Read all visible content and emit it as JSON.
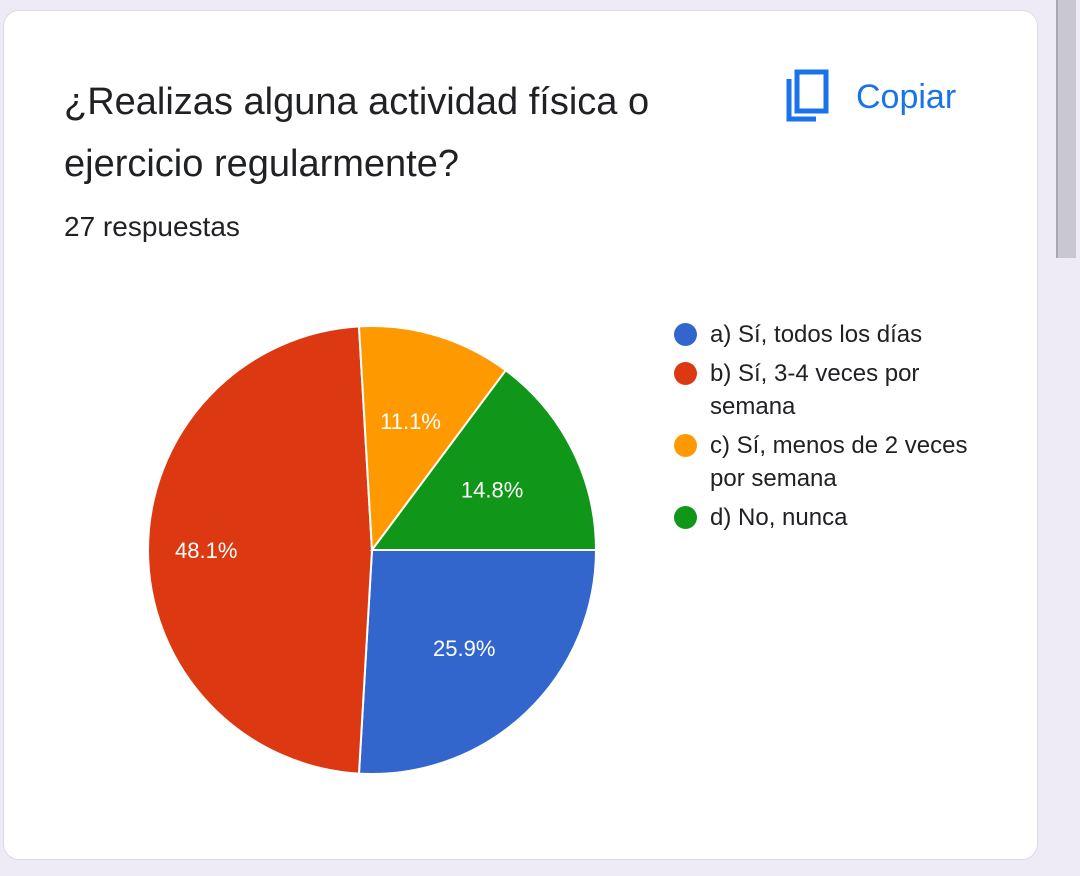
{
  "card": {
    "title": "¿Realizas alguna actividad física o ejercicio regularmente?",
    "copy_label": "Copiar",
    "copy_icon": "copy-icon",
    "responses_text": "27 respuestas"
  },
  "colors": {
    "accent": "#1a73e8",
    "slice_a": "#3366cc",
    "slice_b": "#dc3912",
    "slice_c": "#ff9900",
    "slice_d": "#109618"
  },
  "chart_data": {
    "type": "pie",
    "categories": [
      "a) Sí, todos los días",
      "b) Sí, 3-4 veces por semana",
      "c) Sí, menos de 2 veces por semana",
      "d) No, nunca"
    ],
    "values": [
      25.9,
      48.1,
      11.1,
      14.8
    ],
    "labels": [
      "25.9%",
      "48.1%",
      "11.1%",
      "14.8%"
    ],
    "colors": [
      "#3366cc",
      "#dc3912",
      "#ff9900",
      "#109618"
    ],
    "legend_position": "right"
  }
}
